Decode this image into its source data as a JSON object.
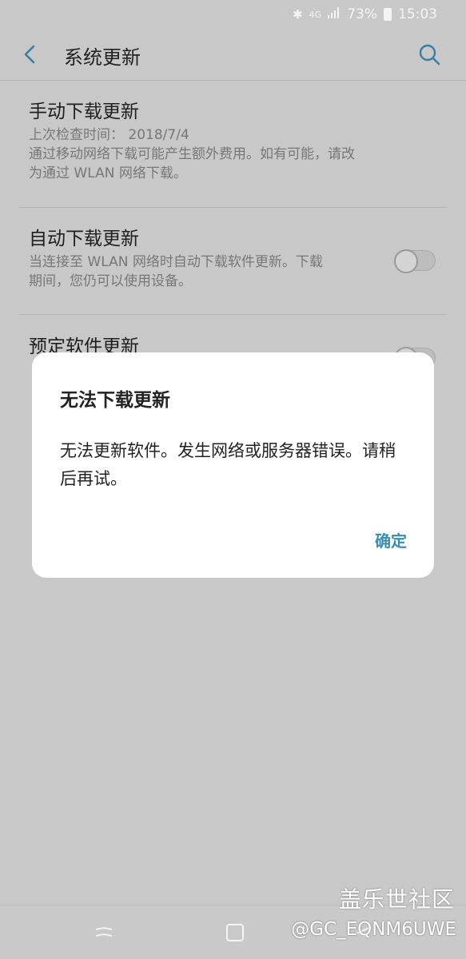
{
  "status_bar": {
    "network": "4G",
    "battery": "73%",
    "time": "15:03"
  },
  "header": {
    "title": "系统更新"
  },
  "settings": [
    {
      "title": "手动下载更新",
      "subtitle_line1": "上次检查时间： 2018/7/4",
      "subtitle_line2": "通过移动网络下载可能产生额外费用。如有可能，请改",
      "subtitle_line3": "为通过 WLAN 网络下载。"
    },
    {
      "title": "自动下载更新",
      "subtitle_line1": "当连接至 WLAN 网络时自动下载软件更新。下载",
      "subtitle_line2": "期间，您仍可以使用设备。",
      "toggle": "off"
    },
    {
      "title": "预定软件更新",
      "toggle": "off"
    }
  ],
  "dialog": {
    "title": "无法下载更新",
    "message": "无法更新软件。发生网络或服务器错误。请稍后再试。",
    "ok_label": "确定"
  },
  "watermark": {
    "brand": "盖乐世社区",
    "user": "@GC_EQNM6UWE"
  },
  "colors": {
    "accent": "#3a8db0",
    "scrim_background": "#c7c7c7",
    "dialog_background": "#ffffff"
  }
}
